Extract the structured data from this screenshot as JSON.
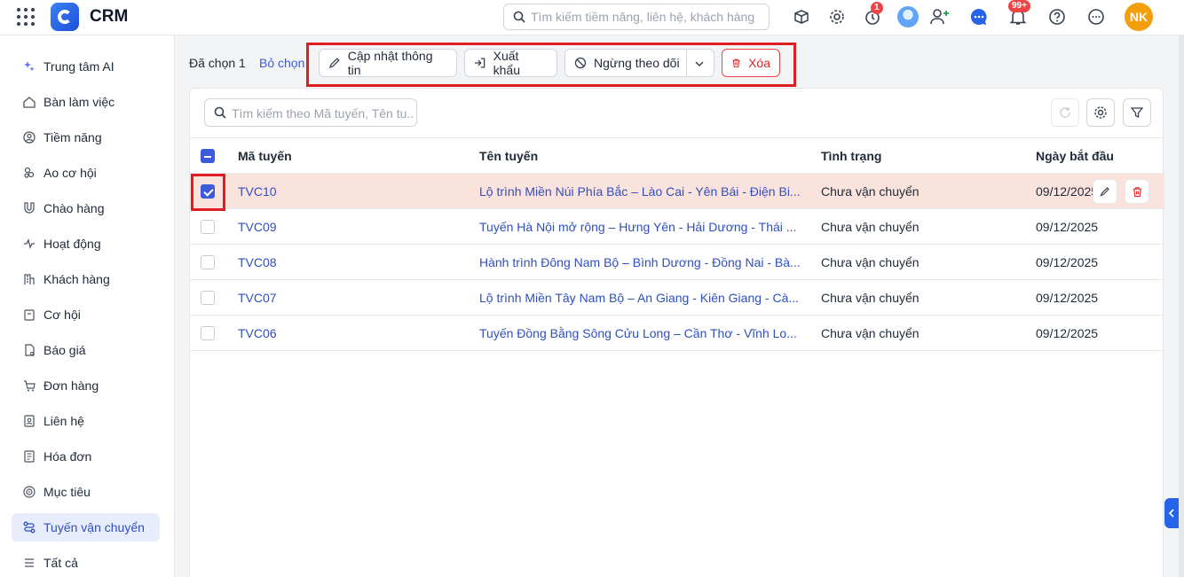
{
  "app": {
    "brand": "CRM"
  },
  "top_search": {
    "placeholder": "Tìm kiếm tiềm năng, liên hệ, khách hàng"
  },
  "top_icons": [
    {
      "icon": "box-search-icon"
    },
    {
      "icon": "settings-icon"
    },
    {
      "icon": "timer-icon",
      "badge": "1"
    },
    {
      "icon": "user-avatar-icon"
    },
    {
      "icon": "add-user-icon"
    },
    {
      "icon": "chat-icon"
    },
    {
      "icon": "bell-icon",
      "badge": "99+"
    },
    {
      "icon": "help-icon"
    },
    {
      "icon": "more-icon"
    }
  ],
  "user": {
    "initials": "NK",
    "color": "#f59e0b"
  },
  "sidebar": {
    "items": [
      {
        "label": "Trung tâm AI",
        "icon": "sparkle-icon"
      },
      {
        "label": "Bàn làm việc",
        "icon": "home-icon"
      },
      {
        "label": "Tiềm năng",
        "icon": "target-user-icon"
      },
      {
        "label": "Ao cơ hội",
        "icon": "people-icon"
      },
      {
        "label": "Chào hàng",
        "icon": "magnet-icon"
      },
      {
        "label": "Hoạt động",
        "icon": "activity-icon"
      },
      {
        "label": "Khách hàng",
        "icon": "building-icon"
      },
      {
        "label": "Cơ hội",
        "icon": "briefcase-icon"
      },
      {
        "label": "Báo giá",
        "icon": "quote-icon"
      },
      {
        "label": "Đơn hàng",
        "icon": "cart-icon"
      },
      {
        "label": "Liên hệ",
        "icon": "contact-icon"
      },
      {
        "label": "Hóa đơn",
        "icon": "invoice-icon"
      },
      {
        "label": "Mục tiêu",
        "icon": "goal-icon"
      },
      {
        "label": "Tuyến vận chuyển",
        "icon": "route-icon",
        "active": true
      },
      {
        "label": "Tất cả",
        "icon": "menu-icon"
      }
    ]
  },
  "bulk_bar": {
    "selected_label": "Đã chọn 1",
    "deselect_label": "Bỏ chọn",
    "update_label": "Cập nhật thông tin",
    "export_label": "Xuất khẩu",
    "unfollow_label": "Ngừng theo dõi",
    "delete_label": "Xóa"
  },
  "table": {
    "search_placeholder": "Tìm kiếm theo Mã tuyến, Tên tu...",
    "columns": [
      "Mã tuyến",
      "Tên tuyến",
      "Tình trạng",
      "Ngày bắt đầu"
    ],
    "rows": [
      {
        "code": "TVC10",
        "name": "Lộ trình Miền Núi Phía Bắc – Lào Cai - Yên Bái - Điện Bi...",
        "status": "Chưa vận chuyển",
        "start": "09/12/2025",
        "selected": true
      },
      {
        "code": "TVC09",
        "name": "Tuyến Hà Nội mở rộng – Hưng Yên - Hải Dương - Thái ...",
        "status": "Chưa vận chuyển",
        "start": "09/12/2025",
        "selected": false
      },
      {
        "code": "TVC08",
        "name": "Hành trình Đông Nam Bộ – Bình Dương - Đồng Nai - Bà...",
        "status": "Chưa vận chuyển",
        "start": "09/12/2025",
        "selected": false
      },
      {
        "code": "TVC07",
        "name": "Lộ trình Miền Tây Nam Bộ – An Giang - Kiên Giang - Cà...",
        "status": "Chưa vận chuyển",
        "start": "09/12/2025",
        "selected": false
      },
      {
        "code": "TVC06",
        "name": "Tuyến Đồng Bằng Sông Cửu Long – Cần Thơ - Vĩnh Lo...",
        "status": "Chưa vận chuyển",
        "start": "09/12/2025",
        "selected": false
      }
    ]
  }
}
